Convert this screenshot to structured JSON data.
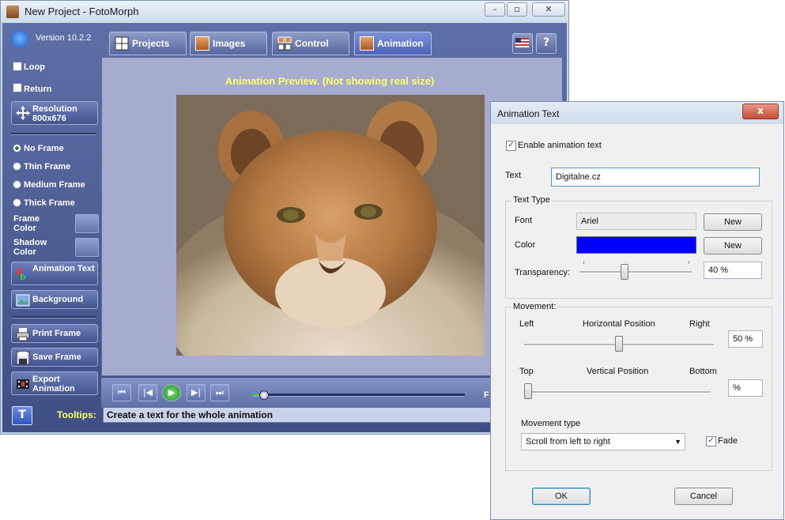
{
  "main_window": {
    "title": "New Project - FotoMorph",
    "version": "Version 10.2.2",
    "tabs": [
      {
        "label": "Projects"
      },
      {
        "label": "Images"
      },
      {
        "label": "Control"
      },
      {
        "label": "Animation",
        "active": true
      }
    ],
    "left_panel": {
      "loop_label": "Loop",
      "return_label": "Return",
      "resolution_label": "Resolution",
      "resolution_value": "800x676",
      "frames": [
        {
          "label": "No Frame",
          "selected": true
        },
        {
          "label": "Thin Frame",
          "selected": false
        },
        {
          "label": "Medium Frame",
          "selected": false
        },
        {
          "label": "Thick Frame",
          "selected": false
        }
      ],
      "frame_color_label": "Frame Color",
      "shadow_color_label": "Shadow Color",
      "animation_text_label": "Animation Text",
      "background_label": "Background",
      "print_frame_label": "Print Frame",
      "save_frame_label": "Save Frame",
      "export_animation_label": "Export Animation"
    },
    "preview_caption": "Animation Preview. (Not showing real size)",
    "player": {
      "progress": 0.05,
      "frame_label_partial": "F"
    },
    "tooltips_label": "Tooltips:",
    "tooltip_text": "Create a text for the whole animation"
  },
  "dialog": {
    "title": "Animation Text",
    "close_glyph": "x",
    "enable_label": "Enable animation text",
    "enable_checked": true,
    "text_label": "Text",
    "text_value": "Digitalne.cz",
    "text_type_label": "Text Type",
    "font_label": "Font",
    "font_value": "Ariel",
    "font_new_label": "New",
    "color_label": "Color",
    "color_value_hex": "#0000ff",
    "color_new_label": "New",
    "transparency_label": "Transparency:",
    "transparency_value": "40 %",
    "transparency_level": 0.4,
    "movement_label": "Movement:",
    "horizontal_left": "Left",
    "horizontal_title": "Horizontal Position",
    "horizontal_right": "Right",
    "horizontal_value": "50 %",
    "horizontal_level": 0.5,
    "vertical_top": "Top",
    "vertical_title": "Vertical Position",
    "vertical_bottom": "Bottom",
    "vertical_value": "%",
    "vertical_level": 0.0,
    "movement_type_label": "Movement type",
    "movement_type_value": "Scroll from left to right",
    "fade_label": "Fade",
    "fade_checked": true,
    "ok_label": "OK",
    "cancel_label": "Cancel"
  },
  "colors": {
    "accent_yellow": "#ffff66",
    "panel_blue": "#4d5e96",
    "selected_color": "#0000ff"
  }
}
